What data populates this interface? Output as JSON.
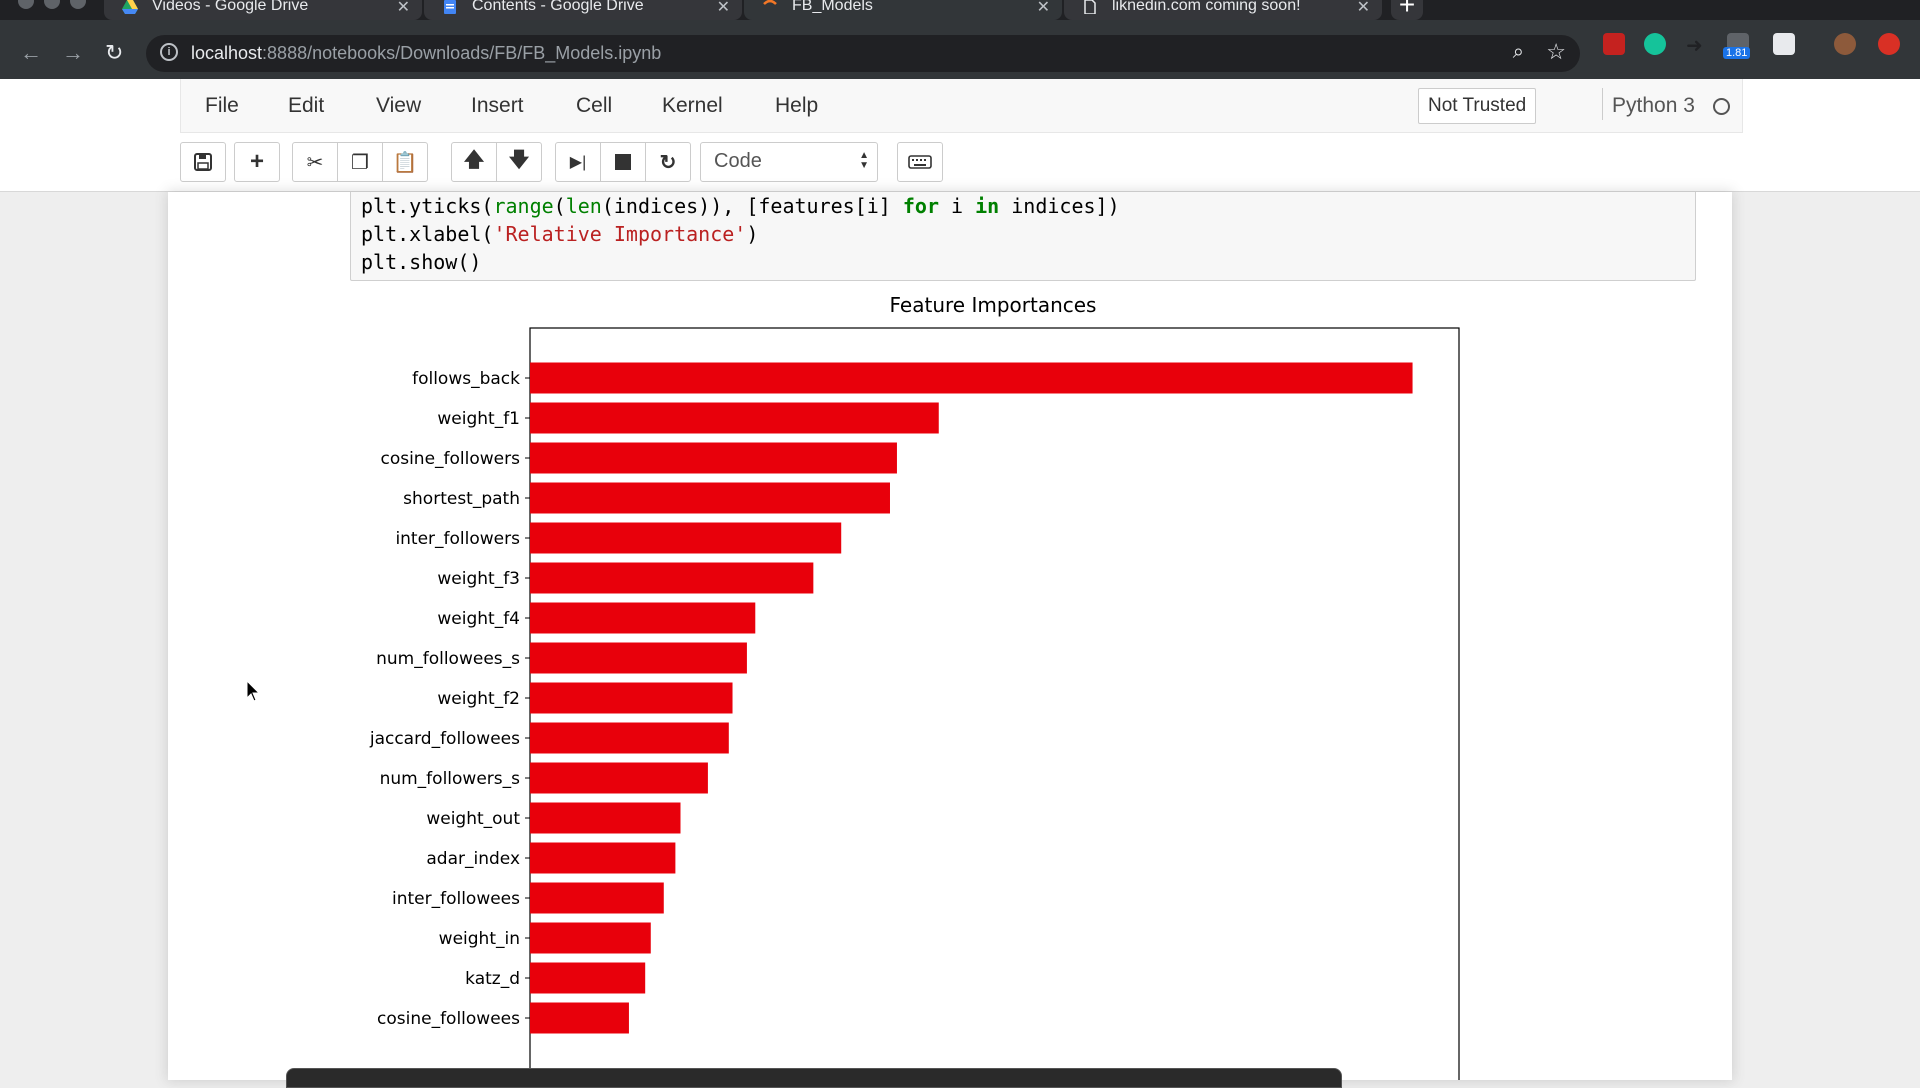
{
  "browser": {
    "tabs": [
      {
        "title": "Videos - Google Drive",
        "icon": "google-drive-icon"
      },
      {
        "title": "Contents - Google Drive",
        "icon": "google-docs-icon"
      },
      {
        "title": "FB_Models",
        "icon": "jupyter-icon"
      },
      {
        "title": "liknedin.com coming soon!",
        "icon": "page-icon"
      }
    ],
    "url_host": "localhost",
    "url_path": ":8888/notebooks/Downloads/FB/FB_Models.ipynb",
    "extension_badge": "1.81"
  },
  "jupyter": {
    "menu": [
      "File",
      "Edit",
      "View",
      "Insert",
      "Cell",
      "Kernel",
      "Help"
    ],
    "trusted_label": "Not Trusted",
    "kernel_name": "Python 3",
    "cell_type": "Code"
  },
  "code": {
    "line1": {
      "a": "plt.yticks(",
      "b": "range",
      "c": "(",
      "d": "len",
      "e": "(indices)), [features[i] ",
      "f": "for",
      "g": " i ",
      "h": "in",
      "i": " indices])"
    },
    "line2": {
      "a": "plt.xlabel(",
      "b": "'Relative Importance'",
      "c": ")"
    },
    "line3": "plt.show()"
  },
  "chart_data": {
    "type": "bar",
    "orientation": "horizontal",
    "title": "Feature Importances",
    "xlabel": "Relative Importance",
    "categories": [
      "follows_back",
      "weight_f1",
      "cosine_followers",
      "shortest_path",
      "inter_followers",
      "weight_f3",
      "weight_f4",
      "num_followees_s",
      "weight_f2",
      "jaccard_followees",
      "num_followers_s",
      "weight_out",
      "adar_index",
      "inter_followees",
      "weight_in",
      "katz_d",
      "cosine_followees"
    ],
    "values": [
      0.19,
      0.088,
      0.079,
      0.0775,
      0.067,
      0.061,
      0.0485,
      0.0467,
      0.0436,
      0.0428,
      0.0383,
      0.0324,
      0.0313,
      0.0288,
      0.026,
      0.0248,
      0.0213
    ],
    "xlim": [
      0,
      0.2
    ],
    "bar_color": "#e8000b"
  }
}
